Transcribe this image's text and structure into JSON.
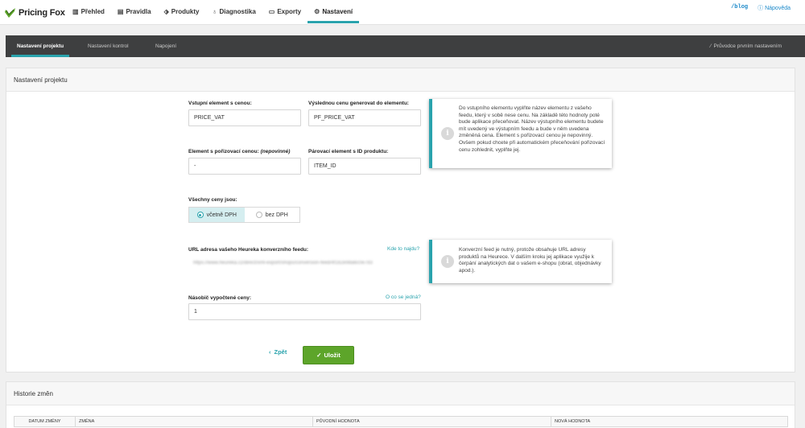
{
  "brand": {
    "name": "Pricing Fox",
    "accent": "#2aa3ad",
    "save_green": "#5da52a"
  },
  "nav": [
    {
      "label": "Přehled",
      "icon": "bar-chart-icon"
    },
    {
      "label": "Pravidla",
      "icon": "list-icon"
    },
    {
      "label": "Produkty",
      "icon": "tags-icon"
    },
    {
      "label": "Diagnostika",
      "icon": "stethoscope-icon"
    },
    {
      "label": "Exporty",
      "icon": "inbox-icon"
    },
    {
      "label": "Nastavení",
      "icon": "gear-icon",
      "active": true
    }
  ],
  "top_right": {
    "blog": "/blog",
    "help": "Nápověda"
  },
  "subnav": {
    "tabs": [
      "Nastavení projektu",
      "Nastavení kontrol",
      "Napojení"
    ],
    "active": "Nastavení projektu",
    "wizard": "Průvodce prvním nastavením"
  },
  "project": {
    "heading": "Nastavení projektu",
    "input_element_label": "Vstupní element s cenou:",
    "input_element_value": "PRICE_VAT",
    "output_element_label": "Výslednou cenu generovat do elementu:",
    "output_element_value": "PF_PRICE_VAT",
    "purchase_label": "Element s pořizovací cenou:",
    "purchase_optional": "(nepovinné)",
    "purchase_value": "-",
    "pairing_label": "Párovací element s ID produktu:",
    "pairing_value": "ITEM_ID",
    "info1": "Do vstupního elementu vyplňte název elementu z vašeho feedu, který v sobě nese cenu. Na základě této hodnoty poté bude aplikace přeceňovat. Název výstupního elementu budete mít uvedený ve výstupním feedu a bude v něm uvedena změněná cena. Element s pořizovací cenou je nepovinný. Ovšem pokud chcete při automatickém přeceňování pořizovací cenu zohlednit, vyplňte jej.",
    "vat_label": "Všechny ceny jsou:",
    "vat_options": [
      "včetně DPH",
      "bez DPH"
    ],
    "vat_selected": "včetně DPH",
    "heureka_label": "URL adresa vašeho Heureka konverzního feedu:",
    "heureka_help": "Kde to najdu?",
    "heureka_value": "https://www.heureka.cz/direct/xml-export/shops/conversion-feed/4f1b2e98a6c0e7d3",
    "info2": "Konverzní feed je nutný, protože obsahuje URL adresy produktů na Heurece. V dalším kroku jej aplikace využije k čerpání analytických dat o vašem e-shopu (obrat, objednávky apod.).",
    "multiplier_label": "Násobič vypočtené ceny:",
    "multiplier_help": "O co se jedná?",
    "multiplier_value": "1",
    "back_label": "Zpět",
    "save_label": "Uložit"
  },
  "history": {
    "heading": "Historie změn",
    "columns": [
      "Datum změny",
      "Změna",
      "Původní hodnota",
      "Nová hodnota"
    ]
  }
}
